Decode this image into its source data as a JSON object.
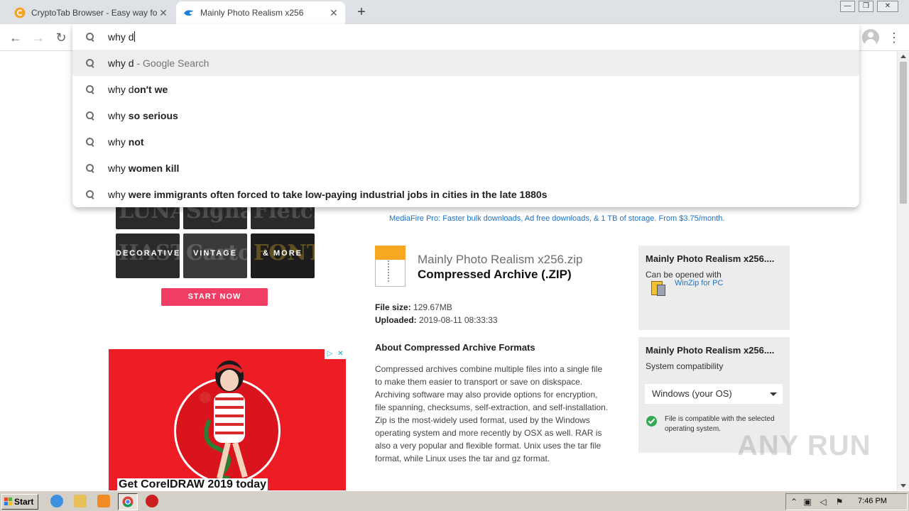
{
  "browser": {
    "tabs": [
      {
        "title": "CryptoTab Browser - Easy way for B",
        "icon": "cryptotab-icon"
      },
      {
        "title": "Mainly Photo Realism x256",
        "icon": "mediafire-icon"
      }
    ],
    "new_tab_symbol": "+",
    "window_controls": {
      "minimize": "—",
      "restore": "❐",
      "close": "✕"
    },
    "nav": {
      "back": "←",
      "forward": "→",
      "reload": "↻",
      "menu": "⋮"
    }
  },
  "omnibox": {
    "typed": "why d",
    "suggestions": [
      {
        "typed": "why d",
        "rest": "",
        "suffix": " - Google Search",
        "selected": true
      },
      {
        "typed": "why d",
        "rest": "on't we",
        "suffix": "",
        "selected": false
      },
      {
        "typed": "why ",
        "rest": "so serious",
        "suffix": "",
        "selected": false
      },
      {
        "typed": "why ",
        "rest": "not",
        "suffix": "",
        "selected": false
      },
      {
        "typed": "why ",
        "rest": "women kill",
        "suffix": "",
        "selected": false
      },
      {
        "typed": "why ",
        "rest": "were immigrants often forced to take low-paying industrial jobs in cities in the late 1880s",
        "suffix": "",
        "selected": false
      }
    ]
  },
  "left_promo": {
    "top_tiles_ghost": [
      "LUNA",
      "Signature",
      "Fletcher"
    ],
    "tiles": [
      {
        "label": "DECORATIVE",
        "ghost": "HASTE"
      },
      {
        "label": "VINTAGE",
        "ghost": "Cartoon"
      },
      {
        "label": "& MORE",
        "ghost": "FONTAINE"
      }
    ],
    "start_now": "START NOW"
  },
  "ad": {
    "headline": "Get CorelDRAW 2019 today",
    "choices": [
      "▷",
      "✕"
    ]
  },
  "file": {
    "promo": "MediaFire Pro: Faster bulk downloads, Ad free downloads, & 1 TB of storage. From $3.75/month.",
    "name": "Mainly Photo Realism x256.zip",
    "type": "Compressed Archive (.ZIP)",
    "size_label": "File size:",
    "size_value": "129.67MB",
    "uploaded_label": "Uploaded:",
    "uploaded_value": "2019-08-11 08:33:33",
    "about_heading": "About Compressed Archive Formats",
    "about_text": "Compressed archives combine multiple files into a single file to make them easier to transport or save on diskspace. Archiving software may also provide options for encryption, file spanning, checksums, self-extraction, and self-installation. Zip is the most-widely used format, used by the Windows operating system and more recently by OSX as well. RAR is also a very popular and flexible format. Unix uses the tar file format, while Linux uses the tar and gz format."
  },
  "sidebar": {
    "open_box": {
      "title": "Mainly Photo Realism x256....",
      "subtitle": "Can be opened with",
      "app_link": "WinZip for PC"
    },
    "compat_box": {
      "title": "Mainly Photo Realism x256....",
      "subtitle": "System compatibility",
      "os_selected": "Windows (your OS)",
      "compat_msg": "File is compatible with the selected operating system."
    }
  },
  "watermark": "ANY RUN",
  "taskbar": {
    "start": "Start",
    "clock": "7:46 PM"
  },
  "colors": {
    "accent": "#1a73c8",
    "start_now": "#ef3d64",
    "ad_red": "#ee1c25",
    "zip_orange": "#f7a823",
    "ok_green": "#34a853"
  }
}
